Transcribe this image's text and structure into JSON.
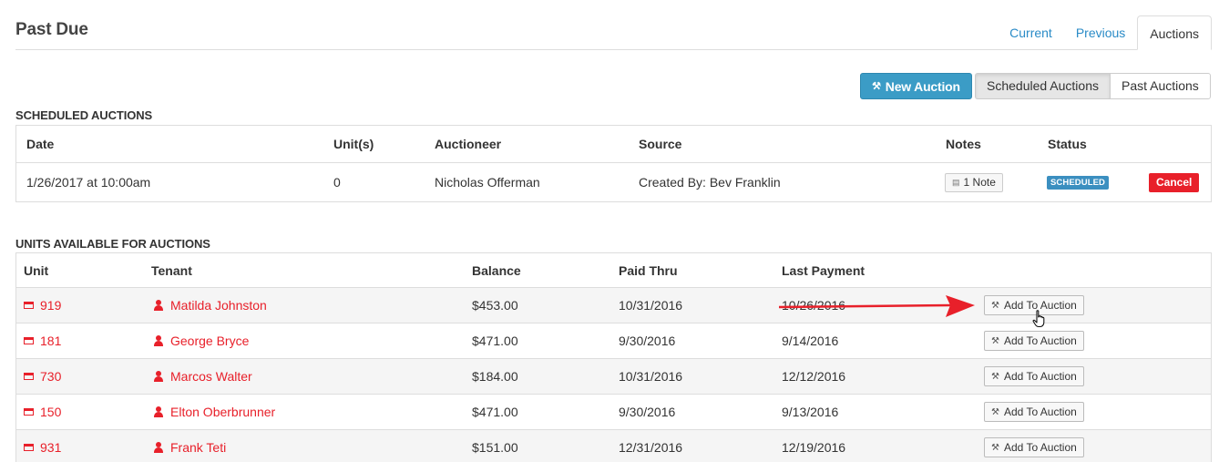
{
  "header": {
    "title": "Past Due",
    "tabs": [
      {
        "label": "Current",
        "active": false
      },
      {
        "label": "Previous",
        "active": false
      },
      {
        "label": "Auctions",
        "active": true
      }
    ]
  },
  "toolbar": {
    "new_auction_label": "New Auction",
    "new_auction_icon": "gavel-icon",
    "scheduled_label": "Scheduled Auctions",
    "past_label": "Past Auctions",
    "accent_color": "#3b9cc6"
  },
  "scheduled": {
    "section_title": "SCHEDULED AUCTIONS",
    "columns": [
      "Date",
      "Unit(s)",
      "Auctioneer",
      "Source",
      "Notes",
      "Status"
    ],
    "rows": [
      {
        "date": "1/26/2017 at 10:00am",
        "units": "0",
        "auctioneer": "Nicholas Offerman",
        "source": "Created By: Bev Franklin",
        "notes_label": "1 Note",
        "status": "SCHEDULED",
        "cancel_label": "Cancel"
      }
    ]
  },
  "units": {
    "section_title": "UNITS AVAILABLE FOR AUCTIONS",
    "columns": [
      "Unit",
      "Tenant",
      "Balance",
      "Paid Thru",
      "Last Payment"
    ],
    "add_label": "Add To Auction",
    "link_color": "#e8202a",
    "rows": [
      {
        "unit": "919",
        "tenant": "Matilda Johnston",
        "balance": "$453.00",
        "paid_thru": "10/31/2016",
        "last_payment": "10/26/2016"
      },
      {
        "unit": "181",
        "tenant": "George Bryce",
        "balance": "$471.00",
        "paid_thru": "9/30/2016",
        "last_payment": "9/14/2016"
      },
      {
        "unit": "730",
        "tenant": "Marcos Walter",
        "balance": "$184.00",
        "paid_thru": "10/31/2016",
        "last_payment": "12/12/2016"
      },
      {
        "unit": "150",
        "tenant": "Elton Oberbrunner",
        "balance": "$471.00",
        "paid_thru": "9/30/2016",
        "last_payment": "9/13/2016"
      },
      {
        "unit": "931",
        "tenant": "Frank Teti",
        "balance": "$151.00",
        "paid_thru": "12/31/2016",
        "last_payment": "12/19/2016"
      }
    ]
  }
}
